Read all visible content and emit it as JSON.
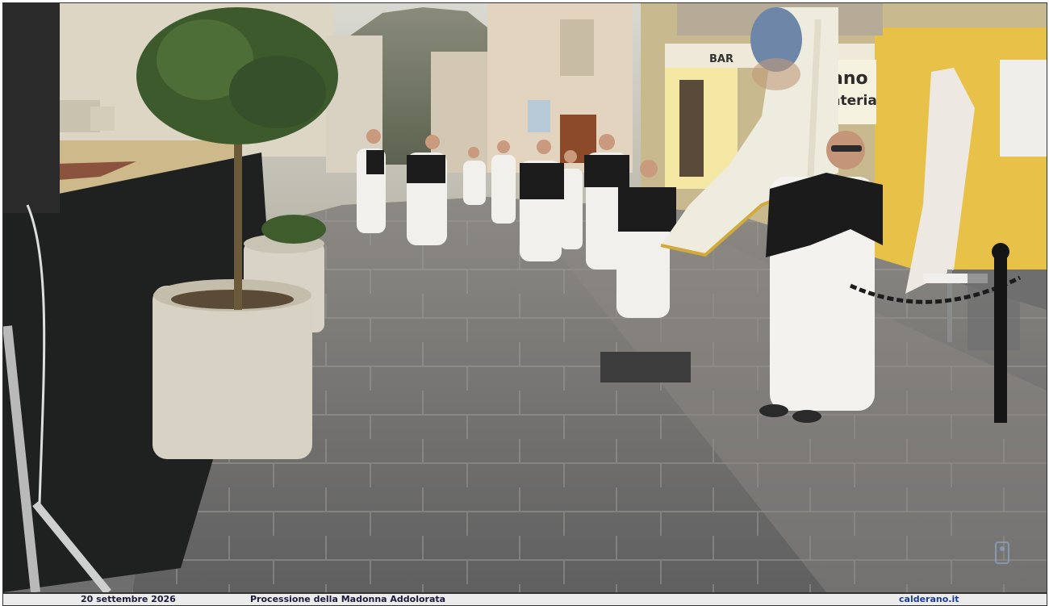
{
  "photo": {
    "alt": "Processione della Madonna Addolorata",
    "signs": {
      "bar": "BAR",
      "shop_line1": "ano",
      "shop_line2": "ateria"
    },
    "watermark_icon": "logo-icon"
  },
  "caption": {
    "date": "20 settembre 2026",
    "title": "Processione della Madonna Addolorata",
    "site": "calderano.it"
  }
}
